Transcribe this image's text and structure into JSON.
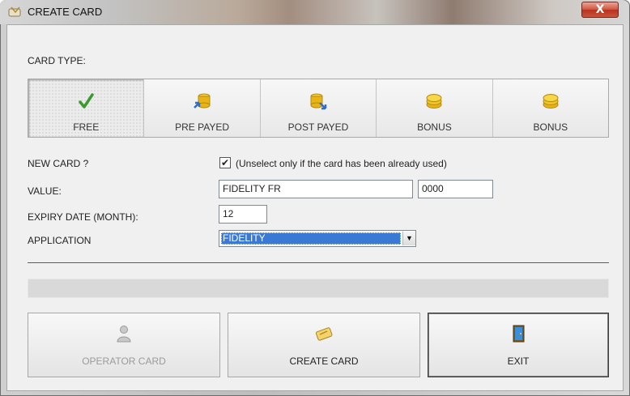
{
  "window": {
    "title": "CREATE CARD",
    "close_label": "X"
  },
  "card_type": {
    "label": "CARD TYPE:",
    "options": [
      {
        "label": "FREE",
        "icon": "checkmark-icon",
        "selected": true
      },
      {
        "label": "PRE PAYED",
        "icon": "coins-prepay-icon",
        "selected": false
      },
      {
        "label": "POST PAYED",
        "icon": "coins-postpay-icon",
        "selected": false
      },
      {
        "label": "BONUS",
        "icon": "coins-bonus-icon",
        "selected": false
      },
      {
        "label": "BONUS",
        "icon": "coins-bonus-icon",
        "selected": false
      }
    ]
  },
  "form": {
    "new_card_label": "NEW CARD ?",
    "new_card_checked": true,
    "new_card_hint": "(Unselect only if the card has been already used)",
    "value_label": "VALUE:",
    "value_text": "FIDELITY FR",
    "value_code": "0000",
    "expiry_label": "EXPIRY DATE (MONTH):",
    "expiry_value": "12",
    "application_label": "APPLICATION",
    "application_selected": "FIDELITY"
  },
  "actions": {
    "operator_card": "OPERATOR CARD",
    "create_card": "CREATE CARD",
    "exit": "EXIT"
  },
  "colors": {
    "selection_blue": "#3a79d4",
    "close_red": "#c9422b",
    "coin_gold": "#e8b519",
    "check_green": "#3a9a2e"
  }
}
